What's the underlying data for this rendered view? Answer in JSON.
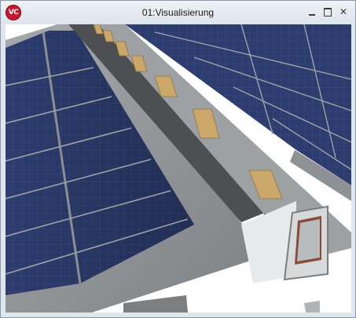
{
  "window": {
    "title": "01:Visualisierung",
    "app_icon_text": "VC",
    "controls": {
      "minimize": "minimize-icon",
      "maximize": "maximize-icon",
      "close": "close-icon"
    }
  },
  "scene": {
    "description_icon": "3d-roof-solar-panels-view",
    "colors": {
      "panel": "#2a3a6a",
      "panel_dark": "#1b2446",
      "roof_tile": "#8f9295",
      "beam": "#5c5e62",
      "rafter_block": "#c9a765",
      "background": "#ffffff"
    }
  }
}
